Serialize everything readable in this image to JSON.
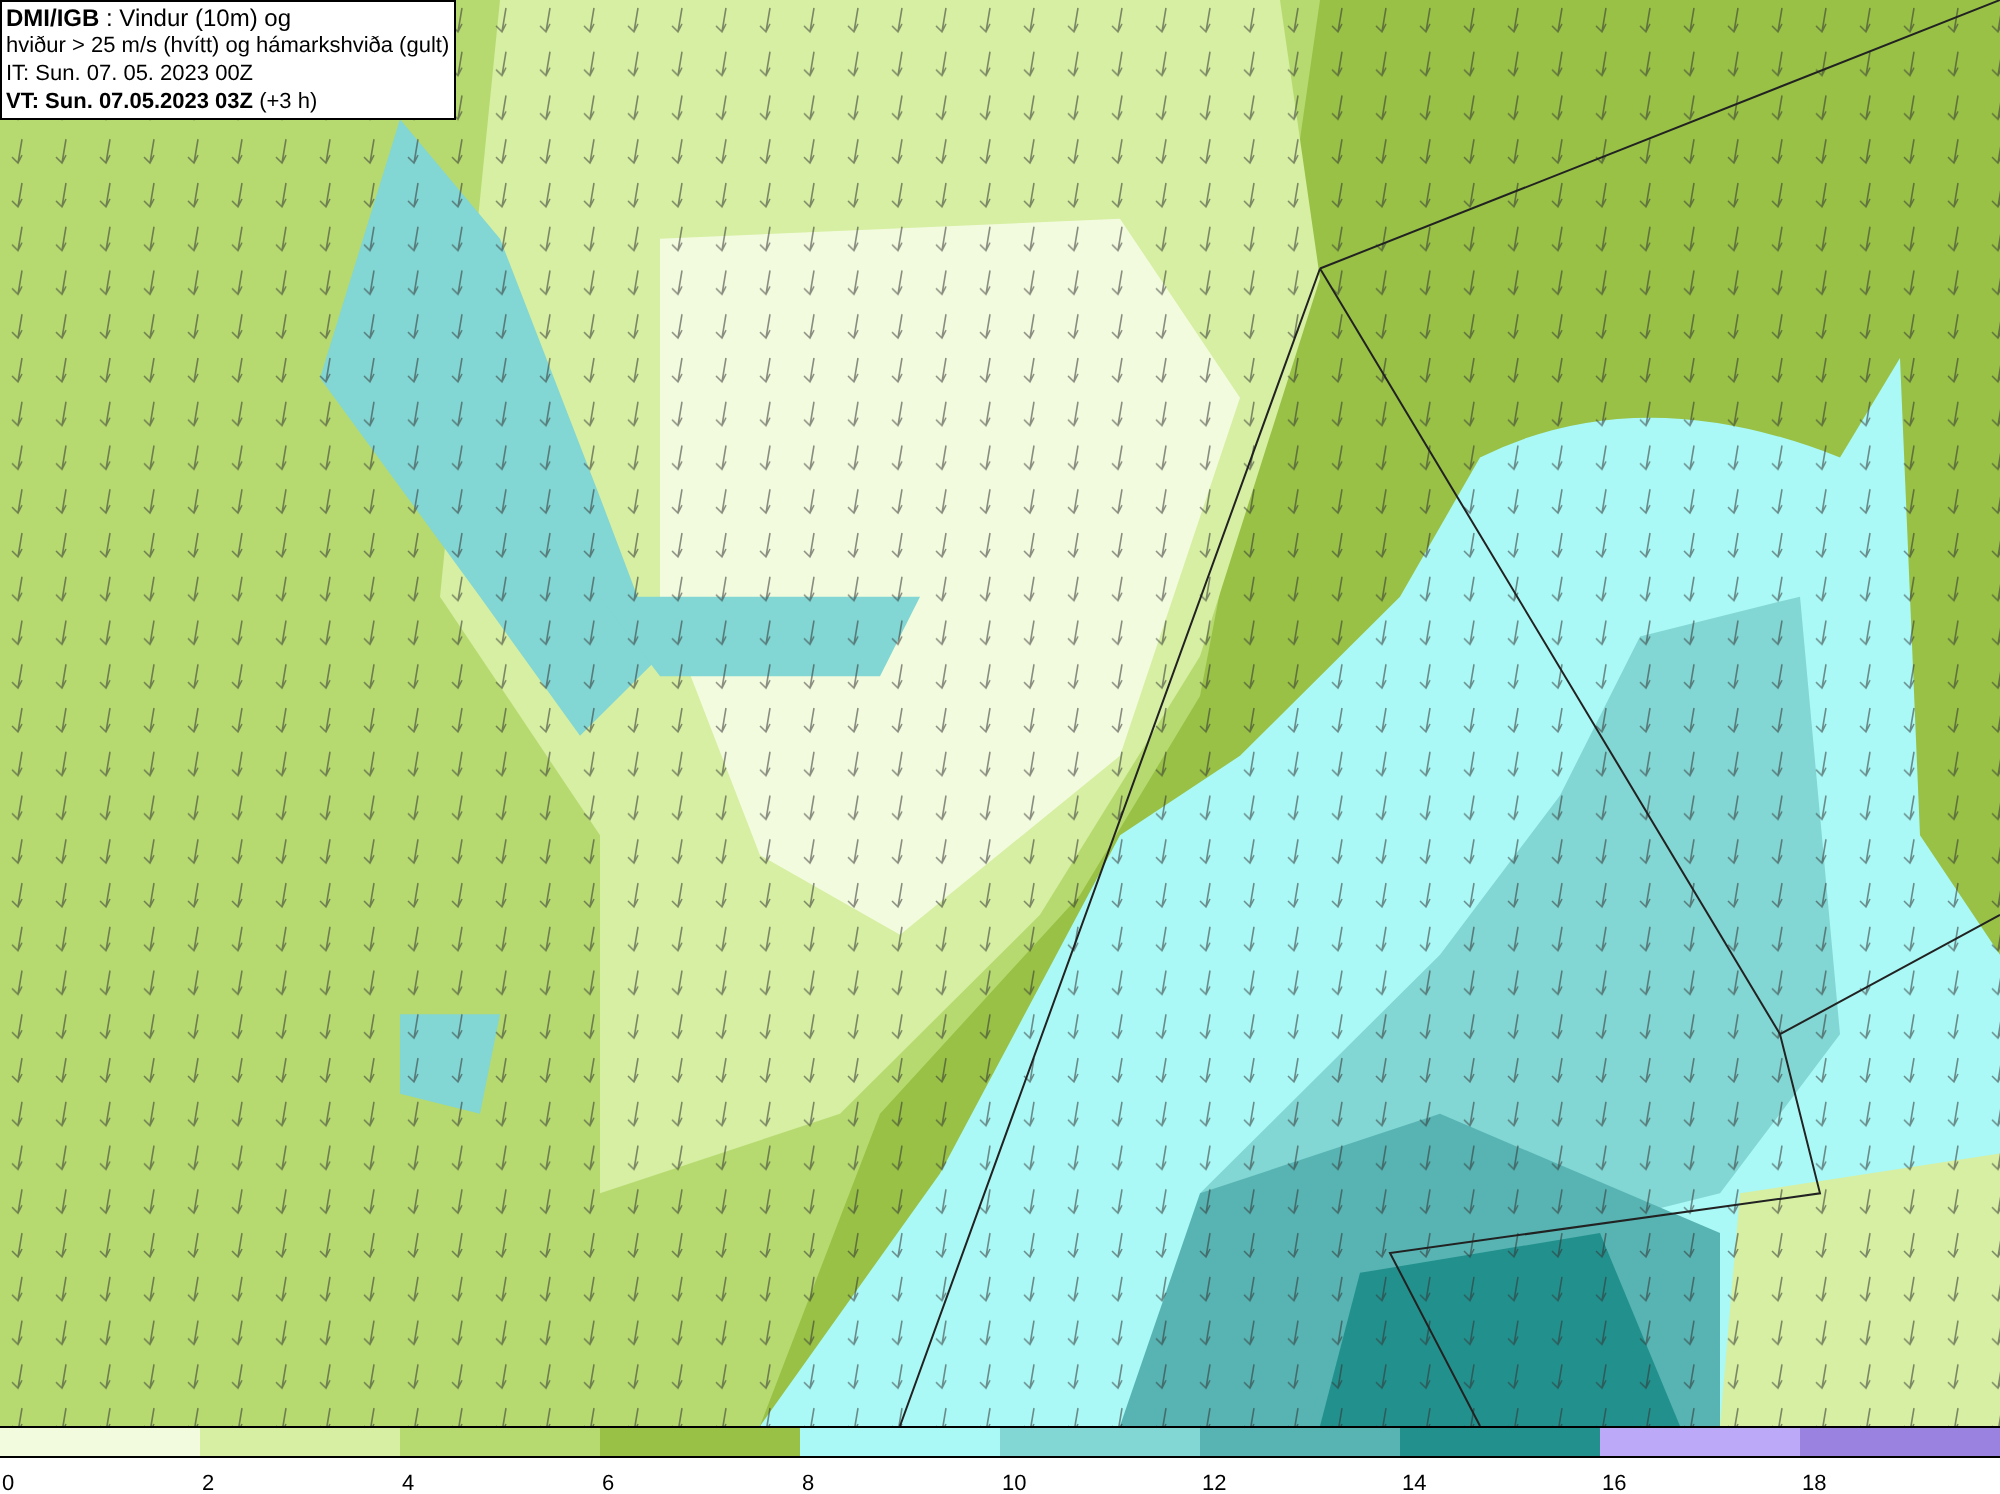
{
  "header": {
    "lines": [
      "**DMI/IGB** : Vindur (10m) og",
      "hviður > 25 m/s (hvítt) og hámarkshviða (gult)",
      "IT: Sun. 07. 05. 2023 00Z",
      "**VT: Sun. 07.05.2023 03Z** (+3 h)"
    ]
  },
  "legend": {
    "segments": [
      {
        "color": "#f3fbde",
        "label": "0"
      },
      {
        "color": "#d6efa2",
        "label": "2"
      },
      {
        "color": "#b6da70",
        "label": "4"
      },
      {
        "color": "#98c146",
        "label": "6"
      },
      {
        "color": "#aaf9f6",
        "label": "8"
      },
      {
        "color": "#82d6d3",
        "label": "10"
      },
      {
        "color": "#57b4b3",
        "label": "12"
      },
      {
        "color": "#22918e",
        "label": "14"
      },
      {
        "color": "#bcaaf8",
        "label": "16"
      },
      {
        "color": "#9a82e0",
        "label": "18"
      }
    ]
  }
}
